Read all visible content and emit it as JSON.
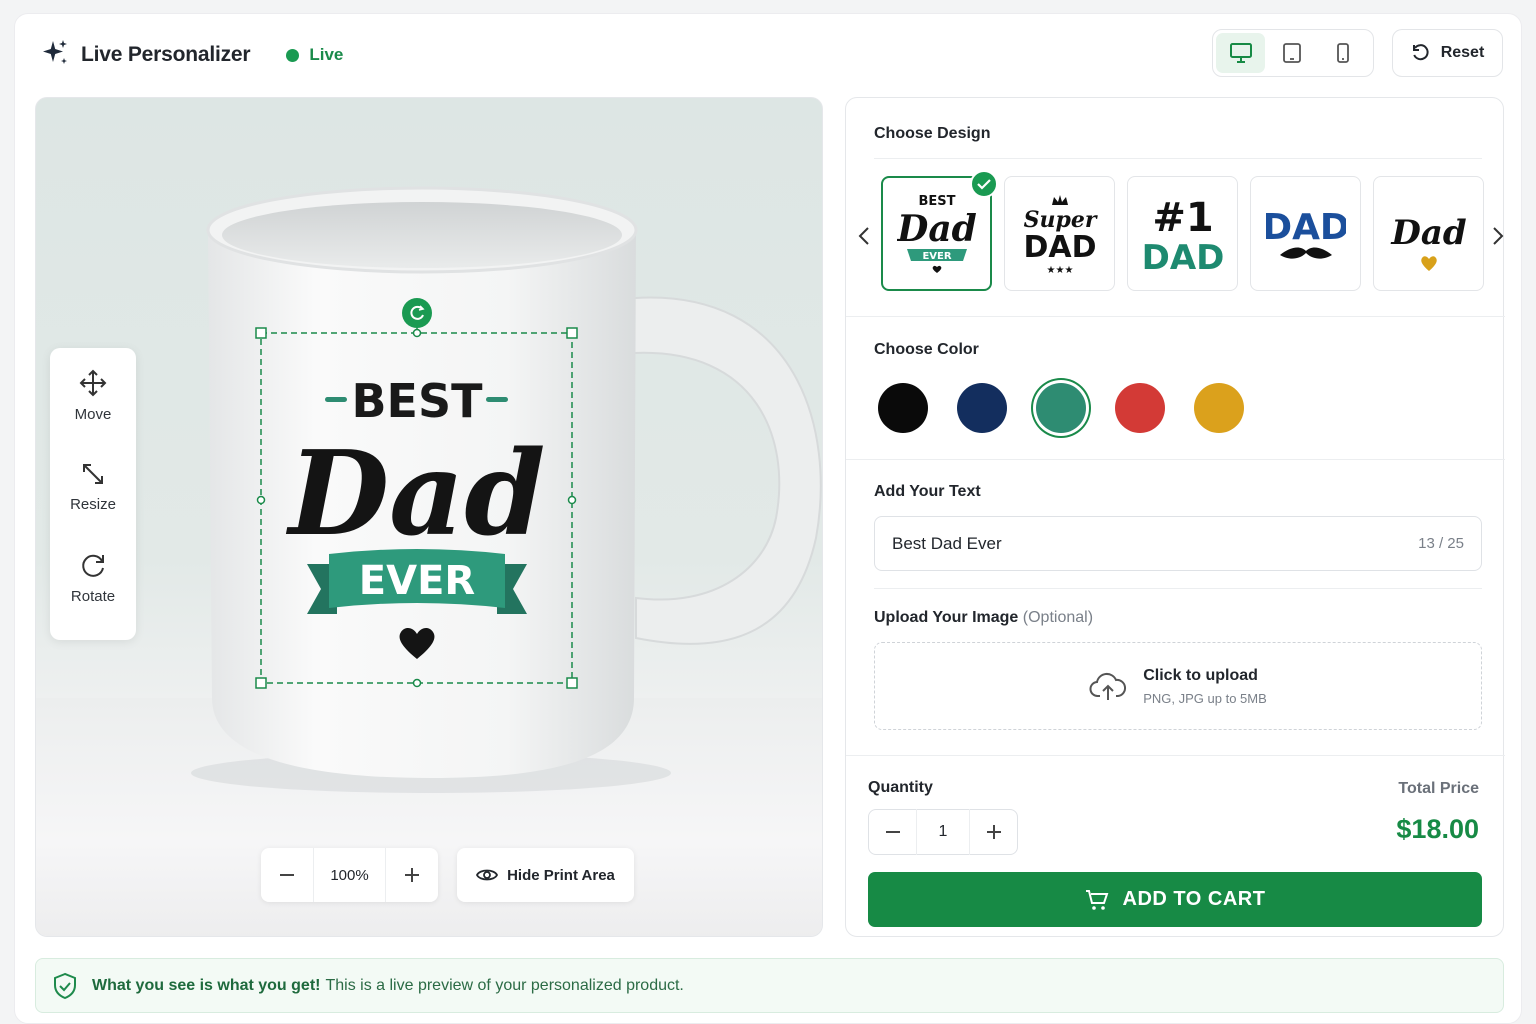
{
  "header": {
    "title": "Live Personalizer",
    "status": "Live",
    "reset_label": "Reset",
    "device_views": [
      "desktop",
      "tablet",
      "mobile"
    ],
    "active_device": "desktop"
  },
  "preview": {
    "tools": [
      {
        "label": "Move",
        "icon": "move-icon"
      },
      {
        "label": "Resize",
        "icon": "resize-icon"
      },
      {
        "label": "Rotate",
        "icon": "rotate-icon"
      }
    ],
    "design_text": {
      "top": "BEST",
      "script": "Dad",
      "ribbon": "EVER"
    },
    "zoom": "100%",
    "hide_print_area_label": "Hide Print Area"
  },
  "panel": {
    "choose_design": {
      "title": "Choose Design",
      "designs": [
        {
          "name": "best-dad-ever",
          "lines": [
            "BEST",
            "Dad",
            "EVER"
          ],
          "selected": true
        },
        {
          "name": "super-dad",
          "lines": [
            "Super",
            "DAD"
          ],
          "selected": false
        },
        {
          "name": "number-one-dad",
          "lines": [
            "#1",
            "DAD"
          ],
          "selected": false
        },
        {
          "name": "dad-mustache",
          "lines": [
            "DAD"
          ],
          "selected": false
        },
        {
          "name": "dad-heart",
          "lines": [
            "Dad"
          ],
          "selected": false
        }
      ]
    },
    "choose_color": {
      "title": "Choose Color",
      "colors": [
        "#0a0a0a",
        "#132e5e",
        "#2e8c72",
        "#d33a36",
        "#dba11c"
      ],
      "selected_index": 2
    },
    "add_text": {
      "title": "Add Your Text",
      "value": "Best Dad Ever",
      "counter": "13 / 25"
    },
    "upload": {
      "title": "Upload Your Image",
      "optional": "(Optional)",
      "main": "Click to upload",
      "sub": "PNG, JPG up to 5MB"
    },
    "quantity": {
      "label": "Quantity",
      "value": "1"
    },
    "total": {
      "label": "Total Price",
      "value": "$18.00"
    },
    "add_to_cart": "ADD TO CART"
  },
  "banner": {
    "bold": "What you see is what you get!",
    "text": "This is a live preview of your personalized product."
  },
  "colors": {
    "accent": "#178a45",
    "accent_light": "#e8f4ec"
  }
}
